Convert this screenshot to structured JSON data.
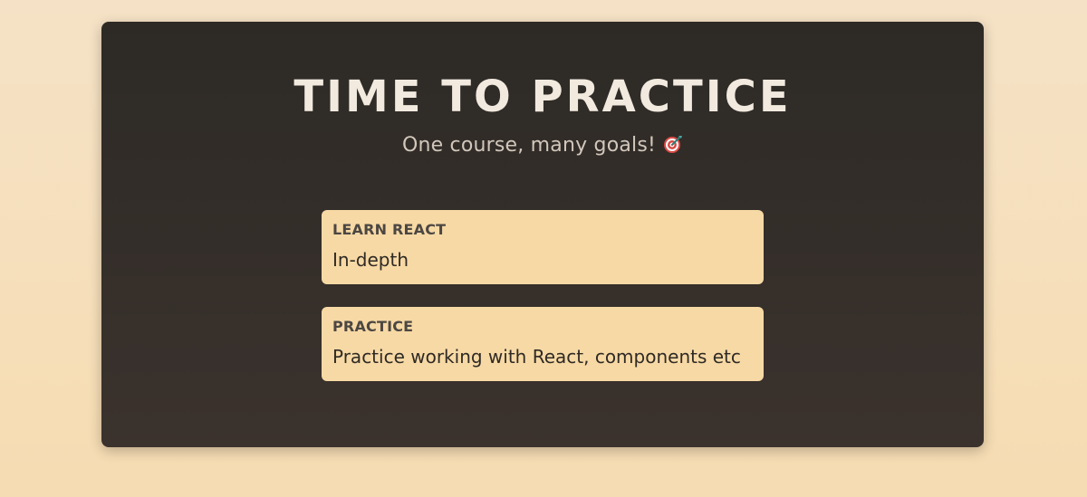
{
  "header": {
    "title": "TIME TO PRACTICE",
    "subtitle": "One course, many goals!",
    "subtitle_icon": "target-dart-icon"
  },
  "goals": [
    {
      "title": "LEARN REACT",
      "description": "In-depth"
    },
    {
      "title": "PRACTICE",
      "description": "Practice working with React, components etc"
    }
  ],
  "colors": {
    "page_bg_top": "#f5e2c6",
    "page_bg_bottom": "#f6dcb2",
    "panel_bg_top": "#2d2a26",
    "panel_bg_bottom": "#3b322d",
    "title_text": "#f2eadf",
    "subtitle_text": "#d2c7bb",
    "card_bg": "#f7d9a5",
    "card_title_text": "#4c4742",
    "card_desc_text": "#2f2a25"
  }
}
